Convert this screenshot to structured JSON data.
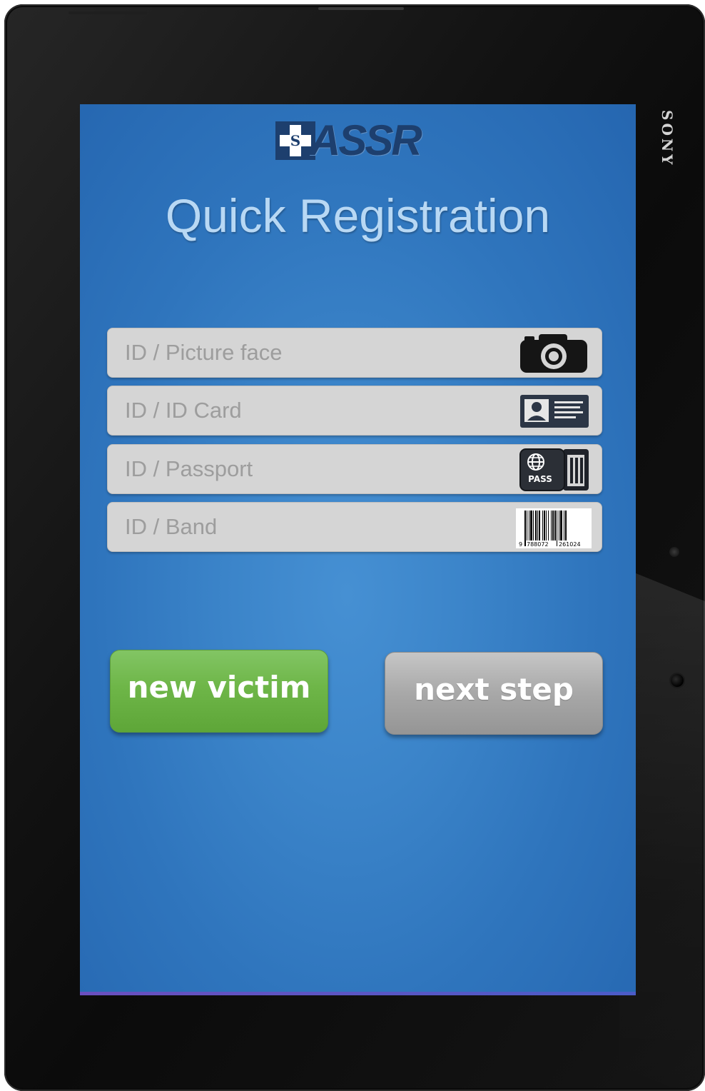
{
  "device": {
    "brand": "SONY"
  },
  "app": {
    "logo_text": "ASSR",
    "logo_badge": "S",
    "title": "Quick Registration"
  },
  "form": {
    "fields": [
      {
        "placeholder": "ID / Picture face",
        "icon": "camera-icon"
      },
      {
        "placeholder": "ID / ID Card",
        "icon": "id-card-icon"
      },
      {
        "placeholder": "ID / Passport",
        "icon": "passport-icon",
        "icon_text": "PASS"
      },
      {
        "placeholder": "ID / Band",
        "icon": "barcode-icon",
        "barcode_digits": [
          "9",
          "788072",
          "261024"
        ]
      }
    ]
  },
  "actions": {
    "new_victim_label": "new victim",
    "next_step_label": "next step"
  },
  "colors": {
    "screen_background": "#3b84c9",
    "title_text": "#b8d8f4",
    "logo": "#1d3f6e",
    "field_background": "#d5d5d5",
    "placeholder_text": "#9d9d9d",
    "new_victim_button": "#6eb648",
    "next_step_button": "#a8a8a8"
  }
}
